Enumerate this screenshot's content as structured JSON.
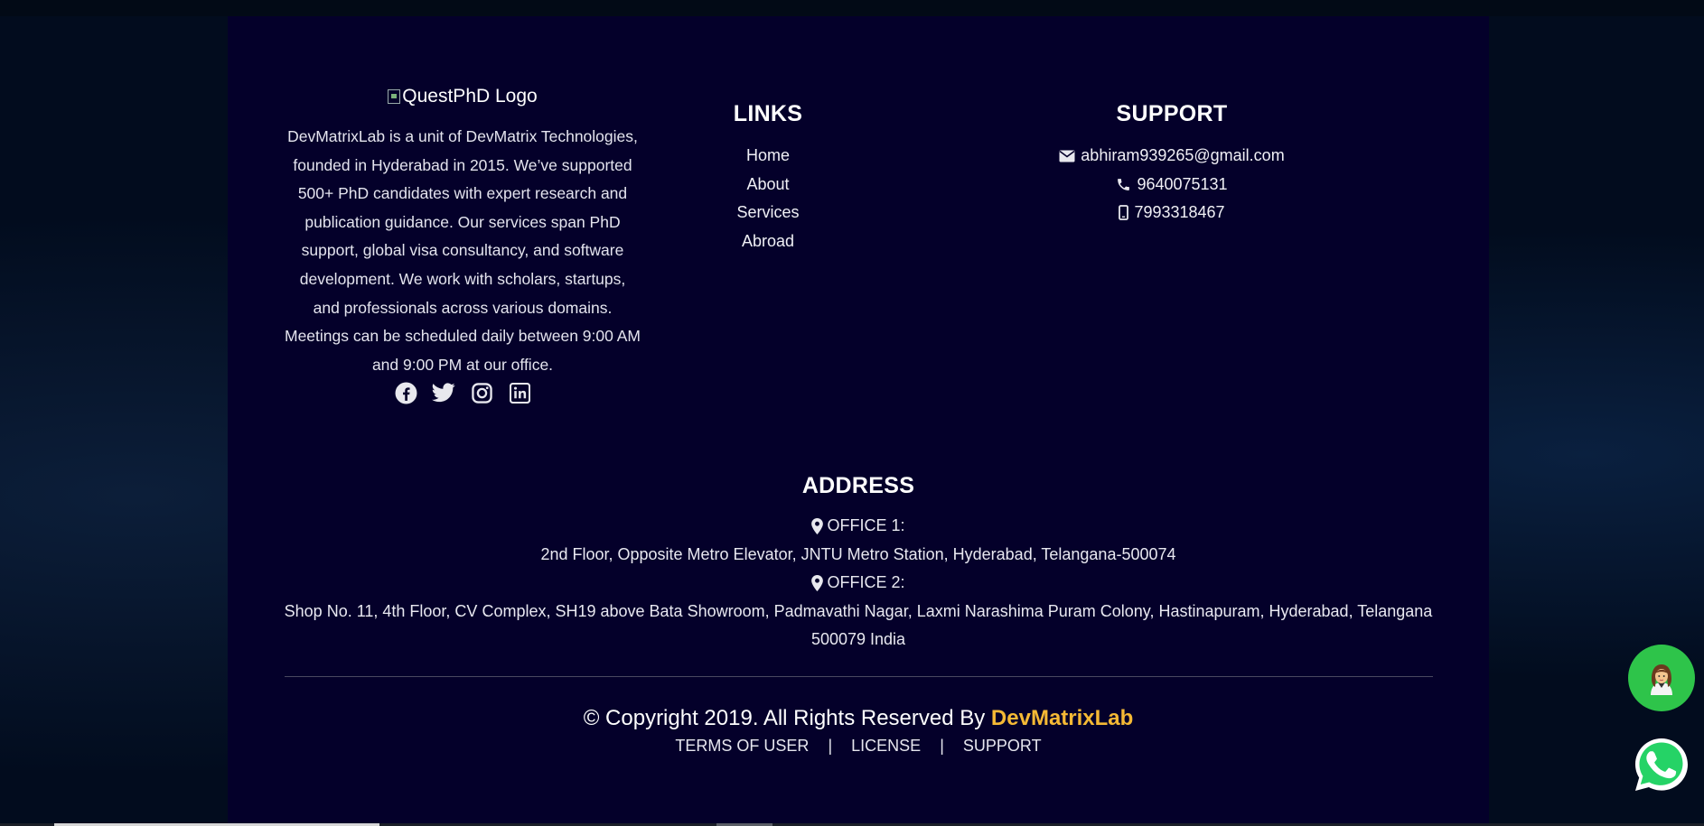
{
  "about": {
    "logo_alt": "QuestPhD Logo",
    "description": "DevMatrixLab is a unit of DevMatrix Technologies, founded in Hyderabad in 2015. We’ve supported 500+ PhD candidates with expert research and publication guidance. Our services span PhD support, global visa consultancy, and software development. We work with scholars, startups, and professionals across various domains. Meetings can be scheduled daily between 9:00 AM and 9:00 PM at our office.",
    "socials": [
      "facebook-icon",
      "twitter-icon",
      "instagram-icon",
      "linkedin-icon"
    ]
  },
  "links": {
    "heading": "LINKS",
    "items": [
      "Home",
      "About",
      "Services",
      "Abroad"
    ]
  },
  "support": {
    "heading": "SUPPORT",
    "email": "abhiram939265@gmail.com",
    "phone": "9640075131",
    "mobile": "7993318467"
  },
  "address": {
    "heading": "ADDRESS",
    "office1_label": "OFFICE 1:",
    "office1_text": "2nd Floor, Opposite Metro Elevator, JNTU Metro Station, Hyderabad, Telangana-500074",
    "office2_label": "OFFICE 2:",
    "office2_text": "Shop No. 11, 4th Floor, CV Complex, SH19 above Bata Showroom, Padmavathi Nagar, Laxmi Narashima Puram Colony, Hastinapuram, Hyderabad, Telangana 500079 India"
  },
  "copyright": {
    "text": "© Copyright 2019. All Rights Reserved By ",
    "brand": "DevMatrixLab"
  },
  "legal": {
    "terms": "TERMS OF USER",
    "license": "LICENSE",
    "support": "SUPPORT",
    "separator": "|"
  },
  "colors": {
    "footer_bg": "#04002a",
    "page_bg": "#020c1e",
    "brand_accent": "#f5b935",
    "chat_button": "#2ec44a",
    "whatsapp": "#25d366"
  }
}
